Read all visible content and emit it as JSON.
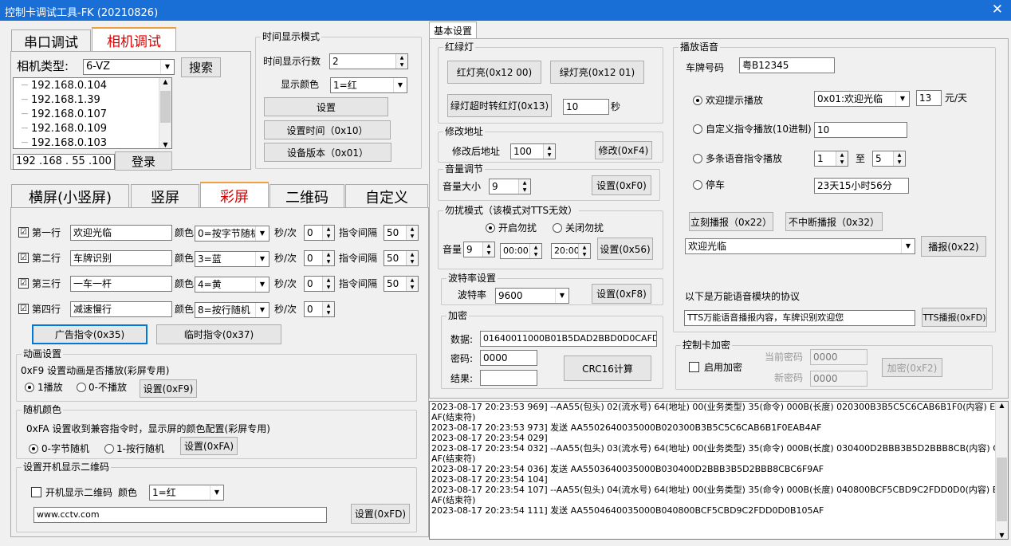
{
  "window": {
    "title": "控制卡调试工具-FK (20210826)",
    "close": "✕"
  },
  "left_tabs": [
    "串口调试",
    "相机调试"
  ],
  "camera": {
    "type_label": "相机类型:",
    "type_value": "6-VZ",
    "search_label": "搜索",
    "ips": [
      "192.168.0.104",
      "192.168.1.39",
      "192.168.0.107",
      "192.168.0.109",
      "192.168.0.103"
    ],
    "ip_input": "192 .168 . 55 .100",
    "login_label": "登录"
  },
  "time_mode": {
    "legend": "时间显示模式",
    "rows_label": "时间显示行数",
    "rows_value": "2",
    "color_label": "显示颜色",
    "color_value": "1=红",
    "set_label": "设置",
    "set_time_label": "设置时间（0x10）",
    "version_label": "设备版本（0x01）"
  },
  "mode_tabs": [
    "横屏(小竖屏)",
    "竖屏",
    "彩屏",
    "二维码",
    "自定义"
  ],
  "lines": [
    {
      "label": "第一行",
      "text": "欢迎光临",
      "color": "0=按字节随机",
      "secs": "0",
      "interval": "50"
    },
    {
      "label": "第二行",
      "text": "车牌识别",
      "color": "3=蓝",
      "secs": "0",
      "interval": "50"
    },
    {
      "label": "第三行",
      "text": "一车一杆",
      "color": "4=黄",
      "secs": "0",
      "interval": "50"
    },
    {
      "label": "第四行",
      "text": "减速慢行",
      "color": "8=按行随机",
      "secs": "0"
    }
  ],
  "line_words": {
    "color": "颜色",
    "per": "秒/次",
    "interval": "指令间隔",
    "check": "☑"
  },
  "ad_btn": "广告指令(0x35)",
  "temp_btn": "临时指令(0x37)",
  "anim": {
    "legend": "动画设置",
    "desc": "0xF9 设置动画是否播放(彩屏专用)",
    "opt1": "1播放",
    "opt2": "0-不播放",
    "set": "设置(0xF9)"
  },
  "randcolor": {
    "legend": "随机颜色",
    "desc": "0xFA 设置收到兼容指令时，显示屏的颜色配置(彩屏专用)",
    "opt1": "0-字节随机",
    "opt2": "1-按行随机",
    "set": "设置(0xFA)"
  },
  "qr": {
    "legend": "设置开机显示二维码",
    "chk_label": "开机显示二维码",
    "color_label": "颜色",
    "color_value": "1=红",
    "url": "www.cctv.com",
    "set": "设置(0xFD)"
  },
  "basic_tab": "基本设置",
  "traffic": {
    "legend": "红绿灯",
    "red": "红灯亮(0x12 00)",
    "green": "绿灯亮(0x12 01)",
    "timeout": "绿灯超时转红灯(0x13)",
    "secs": "10",
    "sec_unit": "秒"
  },
  "addr": {
    "legend": "修改地址",
    "label": "修改后地址",
    "value": "100",
    "btn": "修改(0xF4)"
  },
  "volume": {
    "legend": "音量调节",
    "label": "音量大小",
    "value": "9",
    "btn": "设置(0xF0)"
  },
  "dnd": {
    "legend": "勿扰模式（该模式对TTS无效）",
    "on": "开启勿扰",
    "off": "关闭勿扰",
    "vol_label": "音量",
    "vol": "9",
    "start": "00:00",
    "end": "20:00",
    "btn": "设置(0x56)"
  },
  "baud": {
    "legend": "波特率设置",
    "label": "波特率",
    "value": "9600",
    "btn": "设置(0xF8)"
  },
  "crypto": {
    "legend": "加密",
    "data_label": "数据:",
    "data": "01640011000B01B5DAD2BBD0D0CAFDBEC",
    "pwd_label": "密码:",
    "pwd": "0000",
    "res_label": "结果:",
    "btn": "CRC16计算"
  },
  "voice": {
    "legend": "播放语音",
    "plate_label": "车牌号码",
    "plate": "粤B12345",
    "r1": "欢迎提示播放",
    "r1_sel": "0x01:欢迎光临",
    "r1_price": "13",
    "r1_unit": "元/天",
    "r2": "自定义指令播放(10进制)",
    "r2_val": "10",
    "r3": "多条语音指令播放",
    "r3_from": "1",
    "r3_to_label": "至",
    "r3_to": "5",
    "r4": "停车",
    "r4_val": "23天15小时56分",
    "btn_now": "立刻播报（0x22）",
    "btn_cont": "不中断播报（0x32）",
    "text_sel": "欢迎光临",
    "btn_play": "播报(0x22)",
    "univ_label": "以下是万能语音模块的协议",
    "tts_text": "TTS万能语音播报内容，车牌识别欢迎您",
    "btn_tts": "TTS播报(0xFD)"
  },
  "cardcrypt": {
    "legend": "控制卡加密",
    "enable": "启用加密",
    "cur_label": "当前密码",
    "cur": "0000",
    "new_label": "新密码",
    "new": "0000",
    "btn": "加密(0xF2)"
  },
  "log": [
    "2023-08-17 20:23:53 969] --AA55(包头) 02(流水号) 64(地址) 00(业务类型) 35(命令) 000B(长度) 020300B3B5C5C6CAB6B1F0(内容) EAB4(校验)",
    "AF(结束符)",
    "2023-08-17 20:23:53 973] 发送 AA5502640035000B020300B3B5C5C6CAB6B1F0EAB4AF",
    "2023-08-17 20:23:54 029]",
    "2023-08-17 20:23:54 032] --AA55(包头) 03(流水号) 64(地址) 00(业务类型) 35(命令) 000B(长度) 030400D2BBB3B5D2BBB8CB(内容) C6F9(校验)",
    "AF(结束符)",
    "2023-08-17 20:23:54 036] 发送 AA5503640035000B030400D2BBB3B5D2BBB8CBC6F9AF",
    "2023-08-17 20:23:54 104]",
    "2023-08-17 20:23:54 107] --AA55(包头) 04(流水号) 64(地址) 00(业务类型) 35(命令) 000B(长度) 040800BCF5CBD9C2FDD0D0(内容) B105(校验)",
    "AF(结束符)",
    "2023-08-17 20:23:54 111] 发送 AA5504640035000B040800BCF5CBD9C2FDD0D0B105AF"
  ]
}
